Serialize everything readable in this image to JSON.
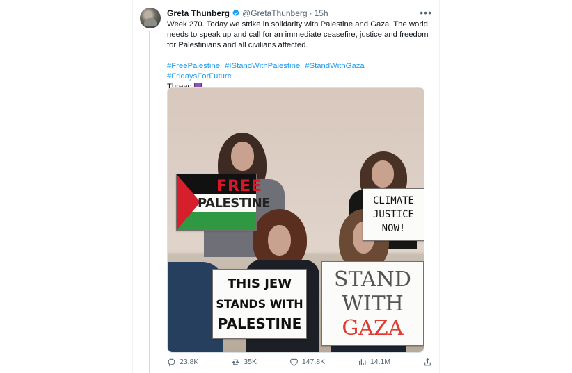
{
  "tweet": {
    "author_name": "Greta Thunberg",
    "handle": "@GretaThunberg",
    "separator": "·",
    "time": "15h",
    "more_label": "•••",
    "text": "Week 270. Today we strike in solidarity with Palestine and Gaza. The world needs to speak up and call for an immediate ceasefire, justice and freedom for Palestinians and all civilians affected.",
    "hashtags": [
      "#FreePalestine",
      "#IStandWithPalestine",
      "#StandWithGaza",
      "#FridaysForFuture"
    ],
    "thread_label": "Thread"
  },
  "image": {
    "signs": {
      "free": "FREE",
      "palestine": "PALESTINE",
      "climate_lines": [
        "CLIMATE",
        "JUSTICE",
        "NOW!"
      ],
      "jew_lines": [
        "THIS JEW",
        "STANDS WITH",
        "PALESTINE"
      ],
      "gaza_lines": [
        "STAND",
        "WITH",
        "GAZA"
      ]
    }
  },
  "actions": {
    "reply_count": "23.8K",
    "retweet_count": "35K",
    "like_count": "147.8K",
    "views_count": "14.1M"
  },
  "colors": {
    "accent": "#1d9bf0",
    "verified": "#1d9bf0",
    "flag_red": "#d71f2b",
    "flag_green": "#2f9842"
  }
}
